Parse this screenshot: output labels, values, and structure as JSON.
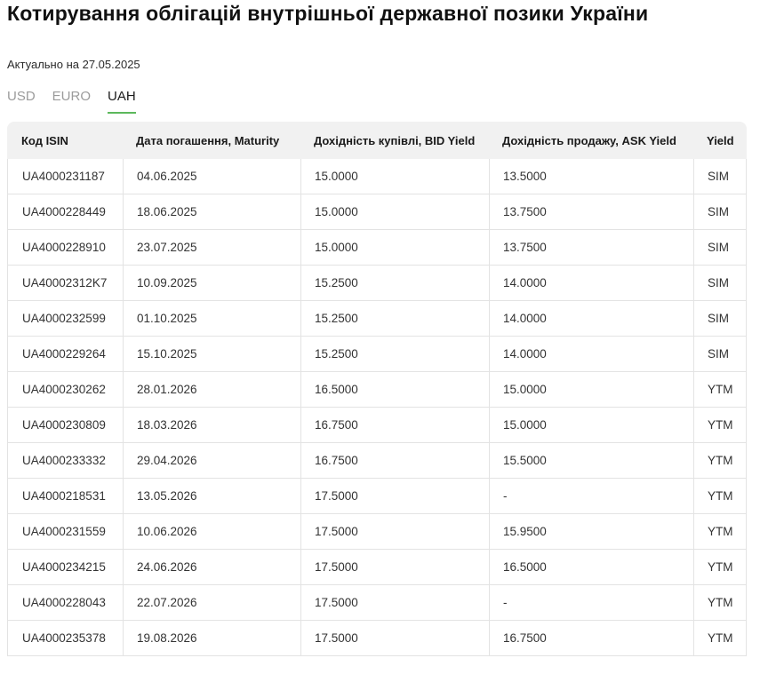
{
  "page": {
    "title": "Котирування облігацій внутрішньої державної позики України",
    "updated_label": "Актуально на 27.05.2025"
  },
  "tabs": [
    {
      "label": "USD",
      "active": false
    },
    {
      "label": "EURO",
      "active": false
    },
    {
      "label": "UAH",
      "active": true
    }
  ],
  "table": {
    "headers": [
      "Код ISIN",
      "Дата погашення, Maturity",
      "Дохідність купівлі, BID Yield",
      "Дохідність продажу, ASK Yield",
      "Yield"
    ],
    "rows": [
      [
        "UA4000231187",
        "04.06.2025",
        "15.0000",
        "13.5000",
        "SIM"
      ],
      [
        "UA4000228449",
        "18.06.2025",
        "15.0000",
        "13.7500",
        "SIM"
      ],
      [
        "UA4000228910",
        "23.07.2025",
        "15.0000",
        "13.7500",
        "SIM"
      ],
      [
        "UA40002312K7",
        "10.09.2025",
        "15.2500",
        "14.0000",
        "SIM"
      ],
      [
        "UA4000232599",
        "01.10.2025",
        "15.2500",
        "14.0000",
        "SIM"
      ],
      [
        "UA4000229264",
        "15.10.2025",
        "15.2500",
        "14.0000",
        "SIM"
      ],
      [
        "UA4000230262",
        "28.01.2026",
        "16.5000",
        "15.0000",
        "YTM"
      ],
      [
        "UA4000230809",
        "18.03.2026",
        "16.7500",
        "15.0000",
        "YTM"
      ],
      [
        "UA4000233332",
        "29.04.2026",
        "16.7500",
        "15.5000",
        "YTM"
      ],
      [
        "UA4000218531",
        "13.05.2026",
        "17.5000",
        "-",
        "YTM"
      ],
      [
        "UA4000231559",
        "10.06.2026",
        "17.5000",
        "15.9500",
        "YTM"
      ],
      [
        "UA4000234215",
        "24.06.2026",
        "17.5000",
        "16.5000",
        "YTM"
      ],
      [
        "UA4000228043",
        "22.07.2026",
        "17.5000",
        "-",
        "YTM"
      ],
      [
        "UA4000235378",
        "19.08.2026",
        "17.5000",
        "16.7500",
        "YTM"
      ]
    ]
  },
  "colors": {
    "accent_green": "#5cb85c",
    "header_bg": "#f1f1f1",
    "border": "#e3e3e3",
    "tab_inactive": "#9b9b9b",
    "text": "#333333"
  }
}
